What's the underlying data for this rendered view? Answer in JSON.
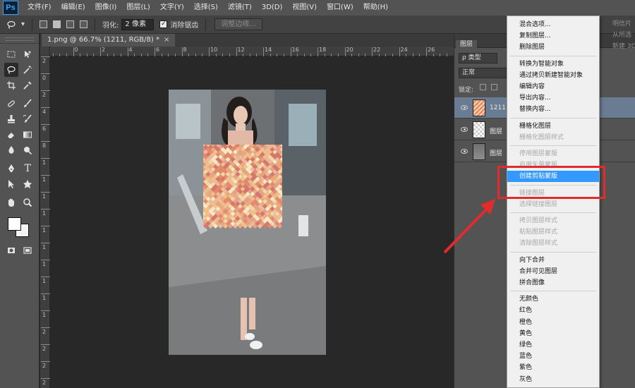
{
  "app": {
    "logo": "Ps"
  },
  "menubar": {
    "items": [
      "文件(F)",
      "编辑(E)",
      "图像(I)",
      "图层(L)",
      "文字(Y)",
      "选择(S)",
      "滤镜(T)",
      "3D(D)",
      "视图(V)",
      "窗口(W)",
      "帮助(H)"
    ]
  },
  "options": {
    "feather_label": "羽化:",
    "feather_value": "2 像素",
    "antialias_label": "消除锯齿",
    "antialias_checked": "✓",
    "refine_edge_label": "调整边缘..."
  },
  "document": {
    "tab_title": "1.png @ 66.7% (1211, RGB/8) *",
    "tab_close": "×",
    "ruler_top": [
      "2",
      "0",
      "2",
      "4",
      "6",
      "8",
      "10",
      "12",
      "14",
      "16",
      "18",
      "20",
      "22",
      "24",
      "26"
    ],
    "ruler_left": [
      "2",
      "0",
      "2",
      "4",
      "6",
      "8",
      "1",
      "1",
      "1",
      "1",
      "1",
      "1",
      "1",
      "1",
      "1",
      "1",
      "2",
      "2",
      "2",
      "2"
    ]
  },
  "layers_panel": {
    "tab": "图层",
    "filter_label": "ρ 类型",
    "blend_mode": "正常",
    "lock_label": "锁定:",
    "layers": [
      {
        "name": "1211",
        "selected": true
      },
      {
        "name": "图层",
        "selected": false
      },
      {
        "name": "图层",
        "selected": false
      }
    ]
  },
  "right_strip": {
    "lines": [
      "明信片",
      "从所选",
      "新建 3D"
    ]
  },
  "context_menu": {
    "items": [
      {
        "label": "混合选项...",
        "disabled": false
      },
      {
        "label": "复制图层...",
        "disabled": false
      },
      {
        "label": "删除图层",
        "disabled": false
      },
      {
        "label": "转换为智能对象",
        "disabled": false
      },
      {
        "label": "通过拷贝新建智能对象",
        "disabled": false
      },
      {
        "label": "编辑内容",
        "disabled": false
      },
      {
        "label": "导出内容...",
        "disabled": false
      },
      {
        "label": "替换内容...",
        "disabled": false
      },
      {
        "label": "栅格化图层",
        "disabled": false
      },
      {
        "label": "栅格化图层样式",
        "disabled": true
      },
      {
        "label": "停用图层蒙版",
        "disabled": true
      },
      {
        "label": "启用矢量蒙版",
        "disabled": true
      },
      {
        "label": "创建剪贴蒙版",
        "disabled": false,
        "highlighted": true
      },
      {
        "label": "链接图层",
        "disabled": true
      },
      {
        "label": "选择链接图层",
        "disabled": true
      },
      {
        "label": "拷贝图层样式",
        "disabled": true
      },
      {
        "label": "粘贴图层样式",
        "disabled": true
      },
      {
        "label": "清除图层样式",
        "disabled": true
      },
      {
        "label": "向下合并",
        "disabled": false
      },
      {
        "label": "合并可见图层",
        "disabled": false
      },
      {
        "label": "拼合图像",
        "disabled": false
      },
      {
        "label": "无颜色",
        "disabled": false
      },
      {
        "label": "红色",
        "disabled": false
      },
      {
        "label": "橙色",
        "disabled": false
      },
      {
        "label": "黄色",
        "disabled": false
      },
      {
        "label": "绿色",
        "disabled": false
      },
      {
        "label": "蓝色",
        "disabled": false
      },
      {
        "label": "紫色",
        "disabled": false
      },
      {
        "label": "灰色",
        "disabled": false
      }
    ]
  },
  "colors": {
    "highlight": "#3399ff",
    "annotation_red": "#e32b2b",
    "selected_layer": "#6a7c92",
    "pattern_palette": [
      "#f3c08a",
      "#eeaa7c",
      "#e68a6c",
      "#d9766b",
      "#f6d8a6",
      "#fbe9c4",
      "#e8a189",
      "#f0b99b"
    ]
  },
  "icons": [
    "lasso-icon",
    "marquee-icon",
    "move-icon",
    "magic-wand-icon",
    "crop-icon",
    "eyedropper-icon",
    "healing-icon",
    "brush-icon",
    "stamp-icon",
    "history-brush-icon",
    "eraser-icon",
    "gradient-icon",
    "blur-icon",
    "dodge-icon",
    "pen-icon",
    "type-icon",
    "path-select-icon",
    "shape-icon",
    "hand-icon",
    "zoom-icon",
    "quickmask-icon",
    "screen-mode-icon",
    "eye-icon"
  ]
}
